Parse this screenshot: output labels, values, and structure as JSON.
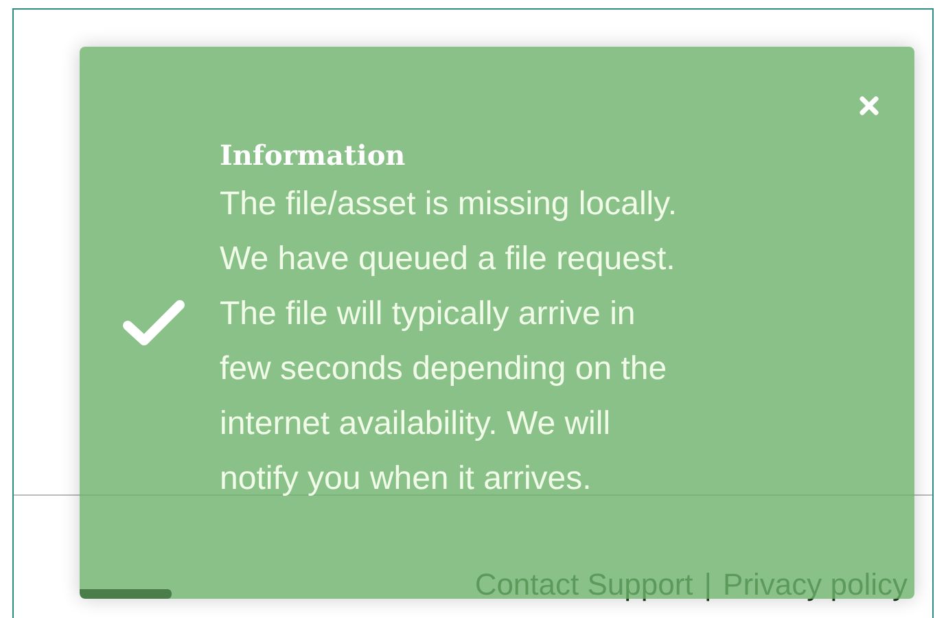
{
  "footer": {
    "links": [
      "Contact Support",
      "Privacy policy"
    ],
    "separator": "|"
  },
  "toast": {
    "title": "Information",
    "message": "The file/asset is missing locally.\nWe have queued a file request.\nThe file will typically arrive in\nfew seconds depending on the\ninternet availability. We will\nnotify you when it arrives.",
    "progress": {
      "level": 0.11
    }
  }
}
